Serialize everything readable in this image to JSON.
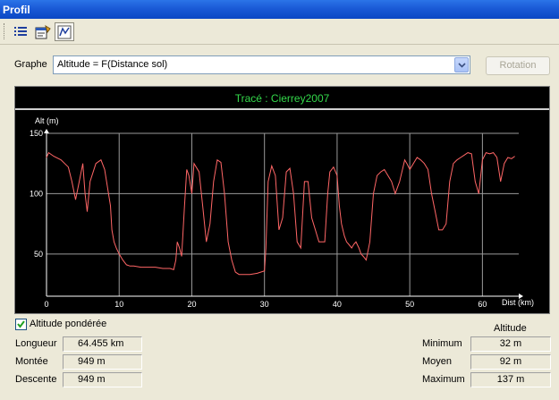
{
  "window": {
    "title": "Profil"
  },
  "toolbar": {
    "icons": [
      "list-icon",
      "properties-icon",
      "profile-graph-icon"
    ]
  },
  "graph_control": {
    "label": "Graphe",
    "selected": "Altitude = F(Distance sol)",
    "rotation_label": "Rotation"
  },
  "chart_data": {
    "type": "line",
    "title": "Tracé : Cierrey2007",
    "ylabel": "Alt (m)",
    "xlabel": "Dist (km)",
    "xlim": [
      0,
      65
    ],
    "ylim": [
      15,
      150
    ],
    "xticks": [
      0,
      10,
      20,
      30,
      40,
      50,
      60
    ],
    "yticks": [
      50,
      100,
      150
    ],
    "grid": true,
    "colors": {
      "background": "#000000",
      "grid": "#9a9a9a",
      "line": "#ff6666",
      "title": "#33d84a",
      "text": "#ffffff"
    },
    "series": [
      {
        "x": [
          0,
          0.3,
          1,
          2,
          3,
          3.5,
          4,
          4.5,
          5,
          5.3,
          5.6,
          6,
          6.8,
          7.5,
          8,
          8.8,
          9,
          9.3,
          9.6,
          10,
          10.5,
          11,
          11.5,
          12,
          13,
          14,
          15,
          16,
          17,
          17.5,
          17.8,
          18,
          18.3,
          18.6,
          19,
          19.3,
          19.6,
          20,
          20.3,
          21,
          21.5,
          22,
          22.5,
          23,
          23.5,
          24,
          24.5,
          25,
          25.5,
          26,
          26.5,
          27,
          28,
          29,
          30,
          30.2,
          30.5,
          31,
          31.5,
          32,
          32.5,
          33,
          33.5,
          34,
          34.5,
          35,
          35.5,
          36,
          36.5,
          37,
          37.5,
          38,
          38.3,
          38.7,
          39,
          39.5,
          40,
          40.3,
          40.6,
          41,
          41.3,
          41.6,
          42,
          42.3,
          42.6,
          43,
          43.3,
          43.6,
          44,
          44.5,
          45,
          45.5,
          46,
          46.5,
          47,
          47.5,
          48,
          48.3,
          48.6,
          49,
          49.3,
          49.6,
          50,
          50.5,
          51,
          51.5,
          52,
          52.5,
          53,
          53.5,
          54,
          54.5,
          55,
          55.5,
          56,
          56.5,
          57,
          57.5,
          58,
          58.5,
          59,
          59.5,
          60,
          60.5,
          61,
          61.5,
          62,
          62.5,
          63,
          63.5,
          64,
          64.455
        ],
        "y": [
          130,
          134,
          131,
          128,
          122,
          110,
          95,
          110,
          125,
          100,
          85,
          110,
          125,
          128,
          120,
          90,
          70,
          60,
          55,
          50,
          45,
          41,
          40,
          40,
          39,
          39,
          39,
          38,
          38,
          37,
          45,
          60,
          55,
          48,
          90,
          120,
          115,
          100,
          125,
          118,
          90,
          60,
          75,
          110,
          128,
          126,
          100,
          60,
          45,
          35,
          33,
          33,
          33,
          34,
          36,
          55,
          110,
          123,
          115,
          70,
          80,
          118,
          121,
          100,
          60,
          55,
          110,
          110,
          80,
          70,
          60,
          60,
          60,
          100,
          118,
          122,
          115,
          90,
          75,
          65,
          60,
          58,
          55,
          58,
          60,
          55,
          50,
          48,
          45,
          60,
          100,
          115,
          118,
          120,
          115,
          110,
          100,
          105,
          110,
          120,
          128,
          125,
          120,
          125,
          130,
          128,
          125,
          120,
          100,
          85,
          70,
          70,
          75,
          110,
          125,
          128,
          130,
          132,
          134,
          133,
          110,
          100,
          128,
          134,
          133,
          134,
          130,
          110,
          125,
          130,
          129,
          131
        ]
      }
    ]
  },
  "options": {
    "weighted_altitude_label": "Altitude pondérée",
    "weighted_altitude_checked": true
  },
  "stats_left": [
    {
      "label": "Longueur",
      "value": "64.455 km"
    },
    {
      "label": "Montée",
      "value": "949 m"
    },
    {
      "label": "Descente",
      "value": "949 m"
    }
  ],
  "stats_right": {
    "header": "Altitude",
    "rows": [
      {
        "label": "Minimum",
        "value": "32 m"
      },
      {
        "label": "Moyen",
        "value": "92 m"
      },
      {
        "label": "Maximum",
        "value": "137 m"
      }
    ]
  }
}
